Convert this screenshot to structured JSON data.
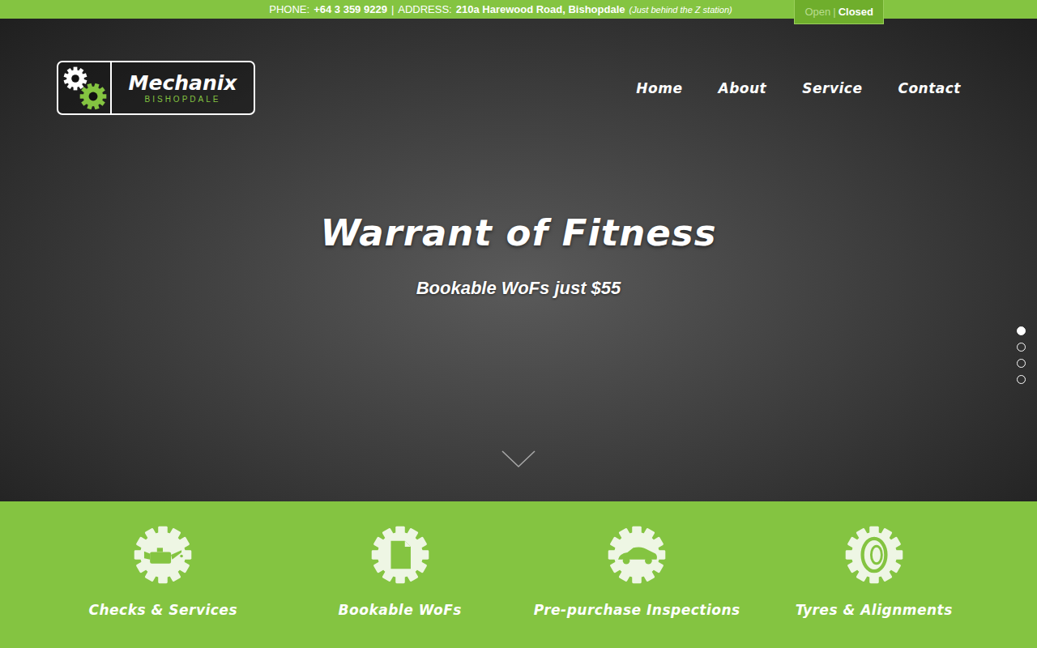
{
  "top_bar": {
    "phone_label": "PHONE:",
    "phone": "+64 3 359 9229",
    "separator": "|",
    "address_label": "ADDRESS:",
    "address": "210a Harewood Road, Bishopdale",
    "address_note": "(Just behind the Z station)",
    "status_separator": "|",
    "status": [
      {
        "label": "Open",
        "selected": false
      },
      {
        "label": "Closed",
        "selected": true
      }
    ]
  },
  "logo": {
    "name": "Mechanix",
    "sub": "BISHOPDALE"
  },
  "nav": [
    {
      "label": "Home"
    },
    {
      "label": "About"
    },
    {
      "label": "Service"
    },
    {
      "label": "Contact"
    }
  ],
  "hero": {
    "title": "Warrant of Fitness",
    "subtitle": "Bookable WoFs just $55",
    "slides": [
      {
        "selected": true
      },
      {
        "selected": false
      },
      {
        "selected": false
      },
      {
        "selected": false
      }
    ]
  },
  "services": [
    {
      "label": "Checks & Services",
      "kind": "oil"
    },
    {
      "label": "Bookable WoFs",
      "kind": "document"
    },
    {
      "label": "Pre-purchase Inspections",
      "kind": "car"
    },
    {
      "label": "Tyres & Alignments",
      "kind": "tyre"
    }
  ]
}
